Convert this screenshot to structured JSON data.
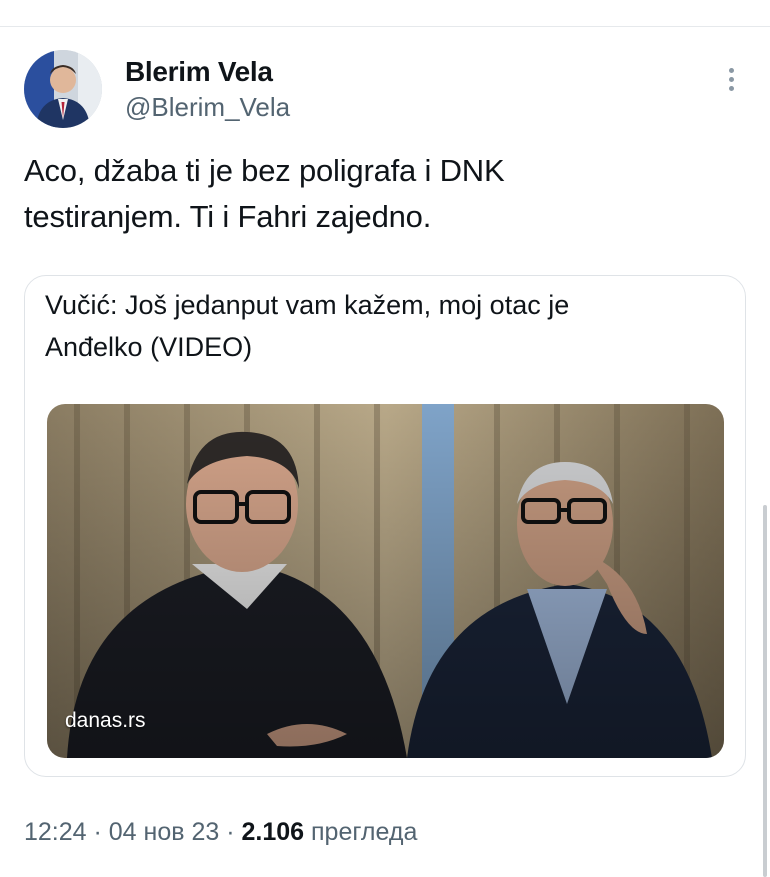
{
  "author": {
    "name": "Blerim Vela",
    "handle": "@Blerim_Vela",
    "avatar_icon": "profile-photo"
  },
  "tweet": {
    "text_line1": "Aco, džaba ti je bez poligrafa i DNK",
    "text_line2": "testiranjem. Ti i Fahri zajedno."
  },
  "link_card": {
    "title_line1": "Vučić: Još jedanput vam kažem, moj otac je",
    "title_line2": "Anđelko (VIDEO)",
    "domain": "danas.rs"
  },
  "meta": {
    "time": "12:24",
    "sep1": " · ",
    "date": "04 нов 23",
    "sep2": " · ",
    "views": "2.106",
    "views_label": " прегледа"
  },
  "colors": {
    "text_primary": "#0f1419",
    "text_secondary": "#536471",
    "border": "#dfe3e7"
  }
}
